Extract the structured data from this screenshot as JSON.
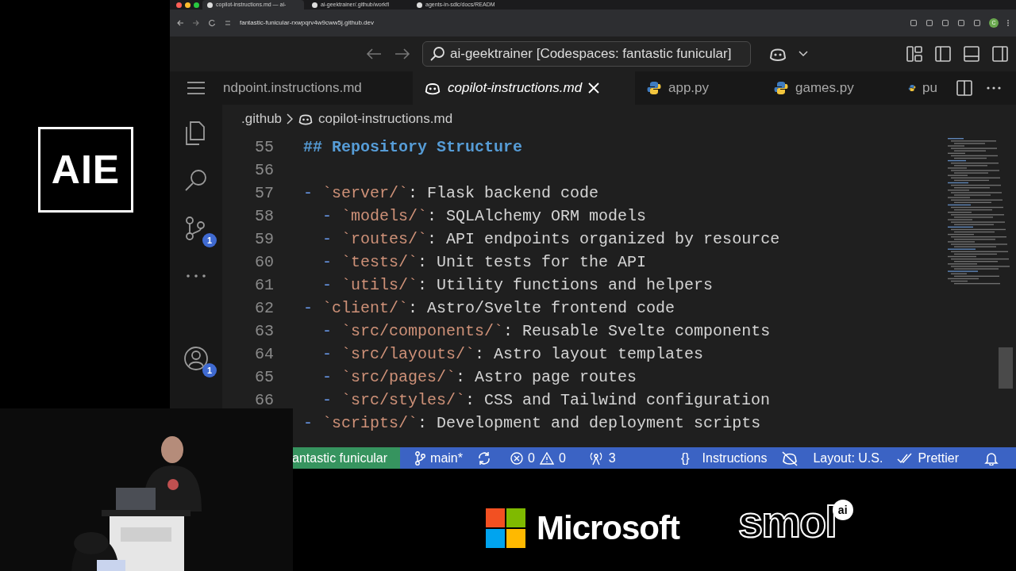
{
  "event_logo": {
    "text": "AIE"
  },
  "browser": {
    "tabs": [
      {
        "title": "copilot-instructions.md — ai-",
        "selected": true
      },
      {
        "title": "ai-geektrainer/.github/workfl",
        "selected": false
      },
      {
        "title": "agents-in-sdlc/docs/READM",
        "selected": false
      }
    ],
    "url": "fantastic-funicular-rxwpqrv4w9cww5j.github.dev",
    "profile": "C"
  },
  "titlebar": {
    "command_center": "ai-geektrainer [Codespaces: fantastic funicular]"
  },
  "editor_tabs": [
    {
      "label": "ndpoint.instructions.md",
      "kind": "none",
      "selected": false,
      "preview": false
    },
    {
      "label": "copilot-instructions.md",
      "kind": "copilot",
      "selected": true,
      "preview": true
    },
    {
      "label": "app.py",
      "kind": "python",
      "selected": false,
      "preview": false
    },
    {
      "label": "games.py",
      "kind": "python",
      "selected": false,
      "preview": false
    },
    {
      "label": "pu",
      "kind": "python",
      "selected": false,
      "preview": false
    }
  ],
  "breadcrumb": [
    {
      "label": ".github",
      "kind": "folder"
    },
    {
      "label": "copilot-instructions.md",
      "kind": "copilot"
    }
  ],
  "activity_bar": [
    {
      "kind": "explorer"
    },
    {
      "kind": "search"
    },
    {
      "kind": "source-control",
      "badge": "1"
    },
    {
      "kind": "more"
    },
    {
      "kind": "accounts",
      "badge": "1"
    }
  ],
  "lines": [
    {
      "number": "55",
      "kind": "heading",
      "text": "## Repository Structure"
    },
    {
      "number": "56",
      "kind": "blank"
    },
    {
      "number": "57",
      "kind": "item",
      "marker": "-",
      "code": "`server/`",
      "text": ": Flask backend code",
      "children": [
        {
          "number": "58",
          "kind": "item",
          "marker": "-",
          "code": "`models/`",
          "text": ": SQLAlchemy ORM models"
        },
        {
          "number": "59",
          "kind": "item",
          "marker": "-",
          "code": "`routes/`",
          "text": ": API endpoints organized by resource"
        },
        {
          "number": "60",
          "kind": "item",
          "marker": "-",
          "code": "`tests/`",
          "text": ": Unit tests for the API"
        },
        {
          "number": "61",
          "kind": "item",
          "marker": "-",
          "code": "`utils/`",
          "text": ": Utility functions and helpers"
        }
      ]
    },
    {
      "number": "62",
      "kind": "item",
      "marker": "-",
      "code": "`client/`",
      "text": ": Astro/Svelte frontend code",
      "children": [
        {
          "number": "63",
          "kind": "item",
          "marker": "-",
          "code": "`src/components/`",
          "text": ": Reusable Svelte components"
        },
        {
          "number": "64",
          "kind": "item",
          "marker": "-",
          "code": "`src/layouts/`",
          "text": ": Astro layout templates"
        },
        {
          "number": "65",
          "kind": "item",
          "marker": "-",
          "code": "`src/pages/`",
          "text": ": Astro page routes"
        },
        {
          "number": "66",
          "kind": "item",
          "marker": "-",
          "code": "`src/styles/`",
          "text": ": CSS and Tailwind configuration"
        }
      ]
    },
    {
      "kind": "item",
      "marker": "-",
      "code": "`scripts/`",
      "text": ": Development and deployment scripts"
    }
  ],
  "status_bar": [
    {
      "kind": "remote",
      "text": "antastic funicular"
    },
    {
      "kind": "branch",
      "text": "main*"
    },
    {
      "kind": "sync"
    },
    {
      "kind": "problems",
      "errors": "0",
      "warnings": "0"
    },
    {
      "kind": "ports",
      "text": "3"
    },
    {
      "kind": "language",
      "glyph": "{}",
      "text": "Instructions"
    },
    {
      "kind": "copilot-off"
    },
    {
      "kind": "layout",
      "text": "Layout: U.S."
    },
    {
      "kind": "prettier",
      "text": "Prettier"
    },
    {
      "kind": "notifications"
    }
  ],
  "sponsors": [
    {
      "kind": "microsoft",
      "text": "Microsoft"
    },
    {
      "kind": "smol",
      "text": "smol",
      "badge": "ai"
    }
  ]
}
